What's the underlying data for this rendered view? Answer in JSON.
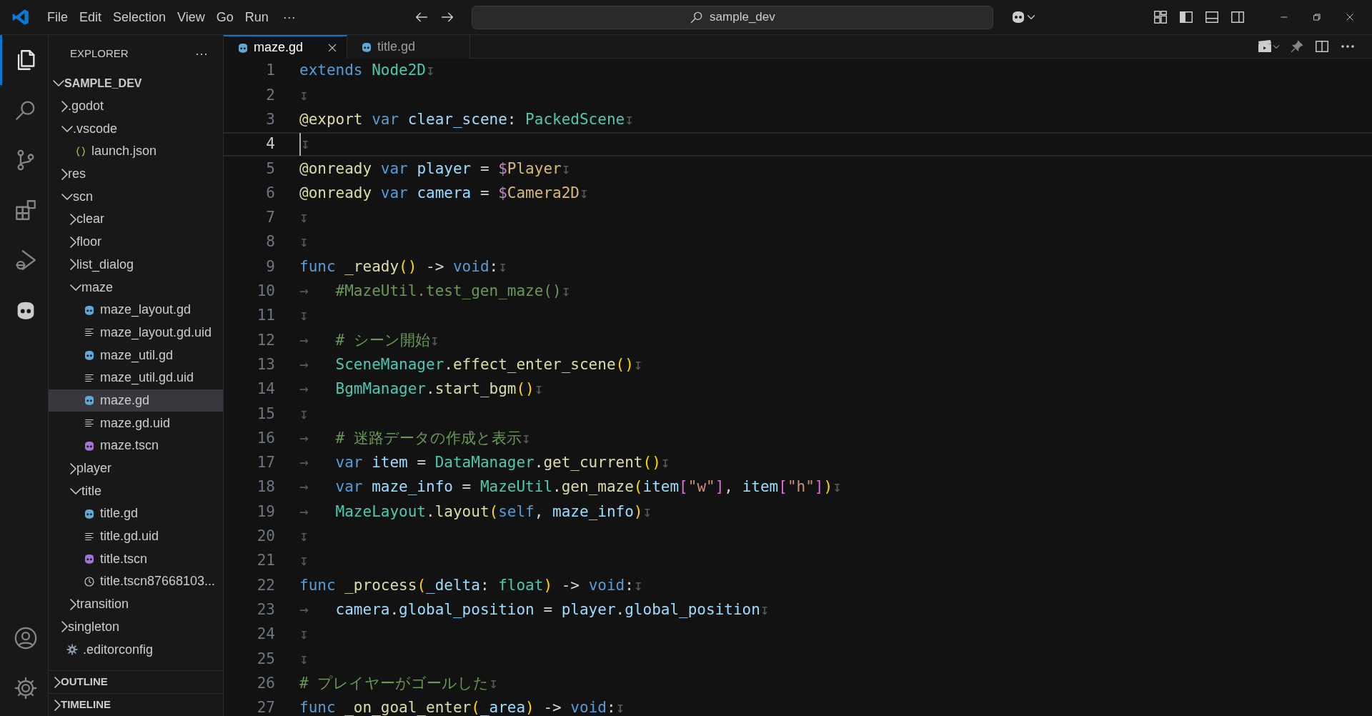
{
  "title_bar": {
    "menu": [
      "File",
      "Edit",
      "Selection",
      "View",
      "Go",
      "Run"
    ],
    "more": "···",
    "search": "sample_dev"
  },
  "activity_bar": {
    "items": [
      {
        "kind": "explorer",
        "selected": true
      },
      {
        "kind": "search",
        "selected": false
      },
      {
        "kind": "source-control",
        "selected": false
      },
      {
        "kind": "extensions",
        "selected": false
      },
      {
        "kind": "run-debug",
        "selected": false
      },
      {
        "kind": "godot",
        "selected": false
      }
    ]
  },
  "sidebar": {
    "title": "EXPLORER",
    "more": "···",
    "root": {
      "name": "SAMPLE_DEV",
      "expanded": true
    },
    "tree": [
      {
        "name": ".godot",
        "kind": "folder",
        "expanded": false,
        "selected": false
      },
      {
        "name": ".vscode",
        "kind": "folder",
        "expanded": true,
        "selected": false,
        "children": [
          {
            "name": "launch.json",
            "kind": "json",
            "selected": false
          }
        ]
      },
      {
        "name": "res",
        "kind": "folder",
        "expanded": false,
        "selected": false
      },
      {
        "name": "scn",
        "kind": "folder",
        "expanded": true,
        "selected": false,
        "children": [
          {
            "name": "clear",
            "kind": "folder",
            "expanded": false,
            "selected": false
          },
          {
            "name": "floor",
            "kind": "folder",
            "expanded": false,
            "selected": false
          },
          {
            "name": "list_dialog",
            "kind": "folder",
            "expanded": false,
            "selected": false
          },
          {
            "name": "maze",
            "kind": "folder",
            "expanded": true,
            "selected": false,
            "children": [
              {
                "name": "maze_layout.gd",
                "kind": "gdscript",
                "selected": false
              },
              {
                "name": "maze_layout.gd.uid",
                "kind": "uid",
                "selected": false
              },
              {
                "name": "maze_util.gd",
                "kind": "gdscript",
                "selected": false
              },
              {
                "name": "maze_util.gd.uid",
                "kind": "uid",
                "selected": false
              },
              {
                "name": "maze.gd",
                "kind": "gdscript",
                "selected": true
              },
              {
                "name": "maze.gd.uid",
                "kind": "uid",
                "selected": false
              },
              {
                "name": "maze.tscn",
                "kind": "scene",
                "selected": false
              }
            ]
          },
          {
            "name": "player",
            "kind": "folder",
            "expanded": false,
            "selected": false
          },
          {
            "name": "title",
            "kind": "folder",
            "expanded": true,
            "selected": false,
            "children": [
              {
                "name": "title.gd",
                "kind": "gdscript",
                "selected": false
              },
              {
                "name": "title.gd.uid",
                "kind": "uid",
                "selected": false
              },
              {
                "name": "title.tscn",
                "kind": "scene",
                "selected": false
              },
              {
                "name": "title.tscn87668103...",
                "kind": "history",
                "selected": false
              }
            ]
          },
          {
            "name": "transition",
            "kind": "folder",
            "expanded": false,
            "selected": false
          }
        ]
      },
      {
        "name": "singleton",
        "kind": "folder",
        "expanded": false,
        "selected": false
      },
      {
        "name": ".editorconfig",
        "kind": "config",
        "selected": false
      }
    ],
    "sections": [
      {
        "name": "OUTLINE",
        "expanded": false
      },
      {
        "name": "TIMELINE",
        "expanded": false
      }
    ]
  },
  "tabs": [
    {
      "label": "maze.gd",
      "selected": true
    },
    {
      "label": "title.gd",
      "selected": false
    }
  ],
  "editor": {
    "lines": [
      {
        "number": "1",
        "current": false,
        "tokens": [
          {
            "kind": "keyword",
            "text": "extends "
          },
          {
            "kind": "type",
            "text": "Node2D"
          },
          {
            "kind": "whitespace",
            "text": "↧"
          }
        ]
      },
      {
        "number": "2",
        "current": false,
        "tokens": [
          {
            "kind": "whitespace",
            "text": "↧"
          }
        ]
      },
      {
        "number": "3",
        "current": false,
        "tokens": [
          {
            "kind": "annotation",
            "text": "@export "
          },
          {
            "kind": "keyword",
            "text": "var "
          },
          {
            "kind": "variable",
            "text": "clear_scene"
          },
          {
            "kind": "plain",
            "text": ": "
          },
          {
            "kind": "type",
            "text": "PackedScene"
          },
          {
            "kind": "whitespace",
            "text": "↧"
          }
        ]
      },
      {
        "number": "4",
        "current": true,
        "tokens": [
          {
            "kind": "whitespace",
            "text": "↧"
          }
        ]
      },
      {
        "number": "5",
        "current": false,
        "tokens": [
          {
            "kind": "annotation",
            "text": "@onready "
          },
          {
            "kind": "keyword",
            "text": "var "
          },
          {
            "kind": "variable",
            "text": "player"
          },
          {
            "kind": "plain",
            "text": " = "
          },
          {
            "kind": "sigil",
            "text": "$"
          },
          {
            "kind": "node",
            "text": "Player"
          },
          {
            "kind": "whitespace",
            "text": "↧"
          }
        ]
      },
      {
        "number": "6",
        "current": false,
        "tokens": [
          {
            "kind": "annotation",
            "text": "@onready "
          },
          {
            "kind": "keyword",
            "text": "var "
          },
          {
            "kind": "variable",
            "text": "camera"
          },
          {
            "kind": "plain",
            "text": " = "
          },
          {
            "kind": "sigil",
            "text": "$"
          },
          {
            "kind": "node",
            "text": "Camera2D"
          },
          {
            "kind": "whitespace",
            "text": "↧"
          }
        ]
      },
      {
        "number": "7",
        "current": false,
        "tokens": [
          {
            "kind": "whitespace",
            "text": "↧"
          }
        ]
      },
      {
        "number": "8",
        "current": false,
        "tokens": [
          {
            "kind": "whitespace",
            "text": "↧"
          }
        ]
      },
      {
        "number": "9",
        "current": false,
        "tokens": [
          {
            "kind": "keyword",
            "text": "func "
          },
          {
            "kind": "function",
            "text": "_ready"
          },
          {
            "kind": "paren",
            "text": "()"
          },
          {
            "kind": "plain",
            "text": " -> "
          },
          {
            "kind": "keyword",
            "text": "void"
          },
          {
            "kind": "plain",
            "text": ":"
          },
          {
            "kind": "whitespace",
            "text": "↧"
          }
        ]
      },
      {
        "number": "10",
        "current": false,
        "tokens": [
          {
            "kind": "whitespace",
            "text": "→   "
          },
          {
            "kind": "comment",
            "text": "#MazeUtil.test_gen_maze()"
          },
          {
            "kind": "whitespace",
            "text": "↧"
          }
        ]
      },
      {
        "number": "11",
        "current": false,
        "tokens": [
          {
            "kind": "whitespace",
            "text": "↧"
          }
        ]
      },
      {
        "number": "12",
        "current": false,
        "tokens": [
          {
            "kind": "whitespace",
            "text": "→   "
          },
          {
            "kind": "comment",
            "text": "# シーン開始"
          },
          {
            "kind": "whitespace",
            "text": "↧"
          }
        ]
      },
      {
        "number": "13",
        "current": false,
        "tokens": [
          {
            "kind": "whitespace",
            "text": "→   "
          },
          {
            "kind": "type",
            "text": "SceneManager"
          },
          {
            "kind": "plain",
            "text": "."
          },
          {
            "kind": "function",
            "text": "effect_enter_scene"
          },
          {
            "kind": "paren",
            "text": "()"
          },
          {
            "kind": "whitespace",
            "text": "↧"
          }
        ]
      },
      {
        "number": "14",
        "current": false,
        "tokens": [
          {
            "kind": "whitespace",
            "text": "→   "
          },
          {
            "kind": "type",
            "text": "BgmManager"
          },
          {
            "kind": "plain",
            "text": "."
          },
          {
            "kind": "function",
            "text": "start_bgm"
          },
          {
            "kind": "paren",
            "text": "()"
          },
          {
            "kind": "whitespace",
            "text": "↧"
          }
        ]
      },
      {
        "number": "15",
        "current": false,
        "tokens": [
          {
            "kind": "whitespace",
            "text": "↧"
          }
        ]
      },
      {
        "number": "16",
        "current": false,
        "tokens": [
          {
            "kind": "whitespace",
            "text": "→   "
          },
          {
            "kind": "comment",
            "text": "# 迷路データの作成と表示"
          },
          {
            "kind": "whitespace",
            "text": "↧"
          }
        ]
      },
      {
        "number": "17",
        "current": false,
        "tokens": [
          {
            "kind": "whitespace",
            "text": "→   "
          },
          {
            "kind": "keyword",
            "text": "var "
          },
          {
            "kind": "variable",
            "text": "item"
          },
          {
            "kind": "plain",
            "text": " = "
          },
          {
            "kind": "type",
            "text": "DataManager"
          },
          {
            "kind": "plain",
            "text": "."
          },
          {
            "kind": "function",
            "text": "get_current"
          },
          {
            "kind": "paren",
            "text": "()"
          },
          {
            "kind": "whitespace",
            "text": "↧"
          }
        ]
      },
      {
        "number": "18",
        "current": false,
        "tokens": [
          {
            "kind": "whitespace",
            "text": "→   "
          },
          {
            "kind": "keyword",
            "text": "var "
          },
          {
            "kind": "variable",
            "text": "maze_info"
          },
          {
            "kind": "plain",
            "text": " = "
          },
          {
            "kind": "type",
            "text": "MazeUtil"
          },
          {
            "kind": "plain",
            "text": "."
          },
          {
            "kind": "function",
            "text": "gen_maze"
          },
          {
            "kind": "paren",
            "text": "("
          },
          {
            "kind": "variable",
            "text": "item"
          },
          {
            "kind": "bracket",
            "text": "["
          },
          {
            "kind": "string",
            "text": "\"w\""
          },
          {
            "kind": "bracket",
            "text": "]"
          },
          {
            "kind": "plain",
            "text": ", "
          },
          {
            "kind": "variable",
            "text": "item"
          },
          {
            "kind": "bracket",
            "text": "["
          },
          {
            "kind": "string",
            "text": "\"h\""
          },
          {
            "kind": "bracket",
            "text": "]"
          },
          {
            "kind": "paren",
            "text": ")"
          },
          {
            "kind": "whitespace",
            "text": "↧"
          }
        ]
      },
      {
        "number": "19",
        "current": false,
        "tokens": [
          {
            "kind": "whitespace",
            "text": "→   "
          },
          {
            "kind": "type",
            "text": "MazeLayout"
          },
          {
            "kind": "plain",
            "text": "."
          },
          {
            "kind": "function",
            "text": "layout"
          },
          {
            "kind": "paren",
            "text": "("
          },
          {
            "kind": "keyword",
            "text": "self"
          },
          {
            "kind": "plain",
            "text": ", "
          },
          {
            "kind": "variable",
            "text": "maze_info"
          },
          {
            "kind": "paren",
            "text": ")"
          },
          {
            "kind": "whitespace",
            "text": "↧"
          }
        ]
      },
      {
        "number": "20",
        "current": false,
        "tokens": [
          {
            "kind": "whitespace",
            "text": "↧"
          }
        ]
      },
      {
        "number": "21",
        "current": false,
        "tokens": [
          {
            "kind": "whitespace",
            "text": "↧"
          }
        ]
      },
      {
        "number": "22",
        "current": false,
        "tokens": [
          {
            "kind": "keyword",
            "text": "func "
          },
          {
            "kind": "function",
            "text": "_process"
          },
          {
            "kind": "paren",
            "text": "("
          },
          {
            "kind": "variable",
            "text": "_delta"
          },
          {
            "kind": "plain",
            "text": ": "
          },
          {
            "kind": "type",
            "text": "float"
          },
          {
            "kind": "paren",
            "text": ")"
          },
          {
            "kind": "plain",
            "text": " -> "
          },
          {
            "kind": "keyword",
            "text": "void"
          },
          {
            "kind": "plain",
            "text": ":"
          },
          {
            "kind": "whitespace",
            "text": "↧"
          }
        ]
      },
      {
        "number": "23",
        "current": false,
        "tokens": [
          {
            "kind": "whitespace",
            "text": "→   "
          },
          {
            "kind": "variable",
            "text": "camera"
          },
          {
            "kind": "plain",
            "text": "."
          },
          {
            "kind": "variable",
            "text": "global_position"
          },
          {
            "kind": "plain",
            "text": " = "
          },
          {
            "kind": "variable",
            "text": "player"
          },
          {
            "kind": "plain",
            "text": "."
          },
          {
            "kind": "variable",
            "text": "global_position"
          },
          {
            "kind": "whitespace",
            "text": "↧"
          }
        ]
      },
      {
        "number": "24",
        "current": false,
        "tokens": [
          {
            "kind": "whitespace",
            "text": "↧"
          }
        ]
      },
      {
        "number": "25",
        "current": false,
        "tokens": [
          {
            "kind": "whitespace",
            "text": "↧"
          }
        ]
      },
      {
        "number": "26",
        "current": false,
        "tokens": [
          {
            "kind": "comment",
            "text": "# プレイヤーがゴールした"
          },
          {
            "kind": "whitespace",
            "text": "↧"
          }
        ]
      },
      {
        "number": "27",
        "current": false,
        "tokens": [
          {
            "kind": "keyword",
            "text": "func "
          },
          {
            "kind": "function",
            "text": "_on_goal_enter"
          },
          {
            "kind": "paren",
            "text": "("
          },
          {
            "kind": "variable",
            "text": "_area"
          },
          {
            "kind": "paren",
            "text": ")"
          },
          {
            "kind": "plain",
            "text": " -> "
          },
          {
            "kind": "keyword",
            "text": "void"
          },
          {
            "kind": "plain",
            "text": ":"
          },
          {
            "kind": "whitespace",
            "text": "↧"
          }
        ]
      }
    ]
  }
}
